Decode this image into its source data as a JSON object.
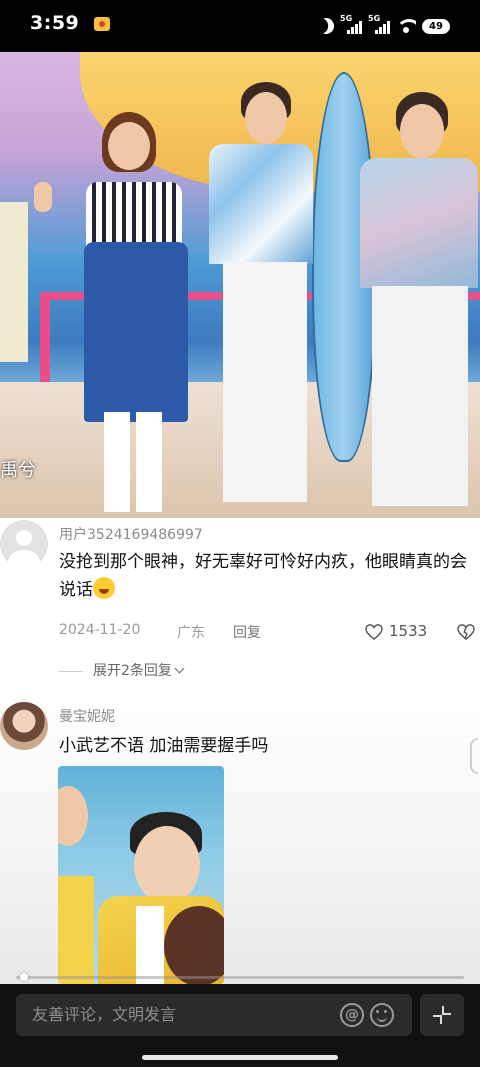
{
  "status_bar": {
    "time": "3:59",
    "network_1": "5G",
    "network_2": "5G",
    "battery": "49"
  },
  "video": {
    "caption": "禹兮"
  },
  "comments": [
    {
      "username": "用户3524169486997",
      "text": "没抢到那个眼神，好无辜好可怜好内疚，他眼睛真的会说话",
      "emoji": "laughing-crying-emoji",
      "date": "2024-11-20",
      "location": "广东",
      "reply_label": "回复",
      "likes": "1533",
      "expand_label": "展开2条回复"
    },
    {
      "username": "曼宝妮妮",
      "text": "小武艺不语 加油需要握手吗",
      "has_image": true
    }
  ],
  "video_progress": 0.01,
  "input": {
    "placeholder": "友善评论，文明发言"
  },
  "colors": {
    "background": "#000000",
    "comment_bg": "#ffffff",
    "input_bg": "#2b2b2b",
    "meta_text": "#9a9a9a"
  },
  "icons": [
    "moon-icon",
    "signal-icon",
    "wifi-icon",
    "battery-icon",
    "heart-icon",
    "dislike-icon",
    "chevron-down-icon",
    "at-icon",
    "emoji-icon",
    "collapse-icon"
  ]
}
